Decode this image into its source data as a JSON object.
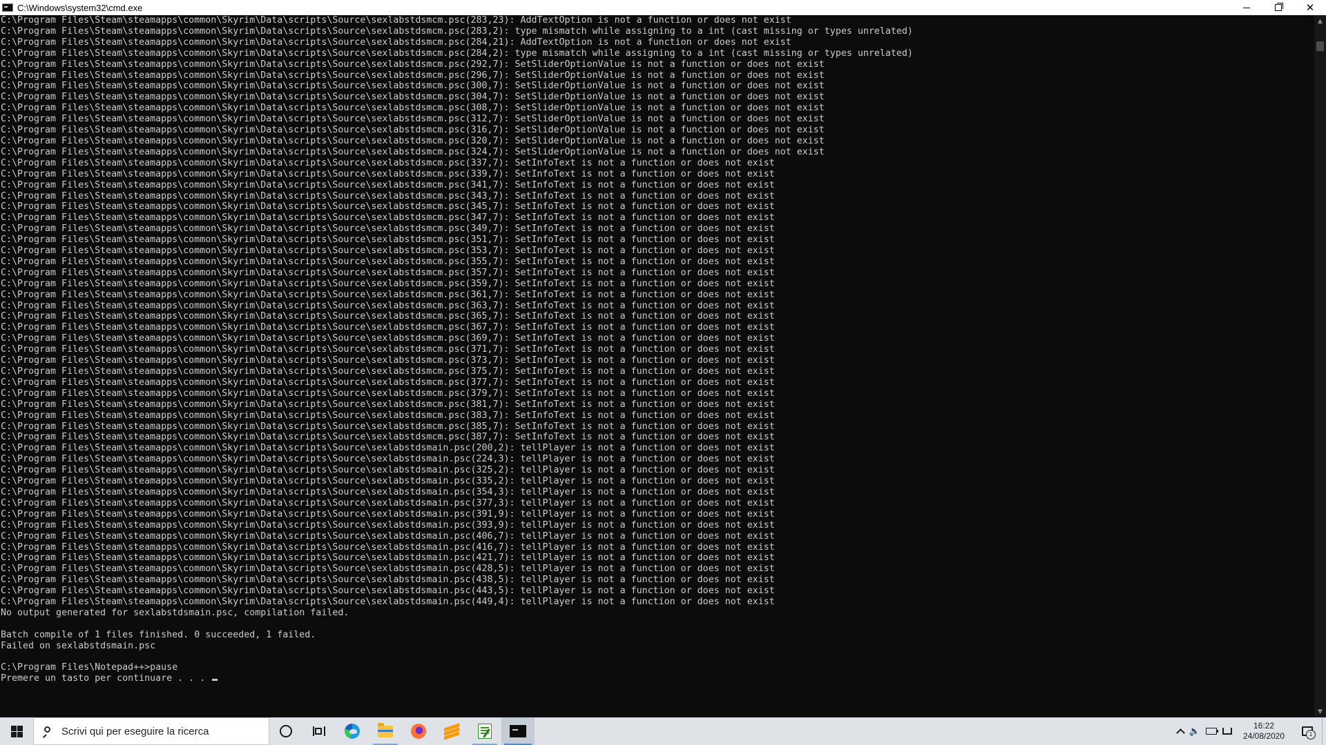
{
  "window": {
    "title": "C:\\Windows\\system32\\cmd.exe",
    "minimize_label": "minimize",
    "maximize_label": "restore",
    "close_label": "close"
  },
  "console": {
    "lines": [
      "C:\\Program Files\\Steam\\steamapps\\common\\Skyrim\\Data\\scripts\\Source\\sexlabstdsmcm.psc(283,23): AddTextOption is not a function or does not exist",
      "C:\\Program Files\\Steam\\steamapps\\common\\Skyrim\\Data\\scripts\\Source\\sexlabstdsmcm.psc(283,2): type mismatch while assigning to a int (cast missing or types unrelated)",
      "C:\\Program Files\\Steam\\steamapps\\common\\Skyrim\\Data\\scripts\\Source\\sexlabstdsmcm.psc(284,21): AddTextOption is not a function or does not exist",
      "C:\\Program Files\\Steam\\steamapps\\common\\Skyrim\\Data\\scripts\\Source\\sexlabstdsmcm.psc(284,2): type mismatch while assigning to a int (cast missing or types unrelated)",
      "C:\\Program Files\\Steam\\steamapps\\common\\Skyrim\\Data\\scripts\\Source\\sexlabstdsmcm.psc(292,7): SetSliderOptionValue is not a function or does not exist",
      "C:\\Program Files\\Steam\\steamapps\\common\\Skyrim\\Data\\scripts\\Source\\sexlabstdsmcm.psc(296,7): SetSliderOptionValue is not a function or does not exist",
      "C:\\Program Files\\Steam\\steamapps\\common\\Skyrim\\Data\\scripts\\Source\\sexlabstdsmcm.psc(300,7): SetSliderOptionValue is not a function or does not exist",
      "C:\\Program Files\\Steam\\steamapps\\common\\Skyrim\\Data\\scripts\\Source\\sexlabstdsmcm.psc(304,7): SetSliderOptionValue is not a function or does not exist",
      "C:\\Program Files\\Steam\\steamapps\\common\\Skyrim\\Data\\scripts\\Source\\sexlabstdsmcm.psc(308,7): SetSliderOptionValue is not a function or does not exist",
      "C:\\Program Files\\Steam\\steamapps\\common\\Skyrim\\Data\\scripts\\Source\\sexlabstdsmcm.psc(312,7): SetSliderOptionValue is not a function or does not exist",
      "C:\\Program Files\\Steam\\steamapps\\common\\Skyrim\\Data\\scripts\\Source\\sexlabstdsmcm.psc(316,7): SetSliderOptionValue is not a function or does not exist",
      "C:\\Program Files\\Steam\\steamapps\\common\\Skyrim\\Data\\scripts\\Source\\sexlabstdsmcm.psc(320,7): SetSliderOptionValue is not a function or does not exist",
      "C:\\Program Files\\Steam\\steamapps\\common\\Skyrim\\Data\\scripts\\Source\\sexlabstdsmcm.psc(324,7): SetSliderOptionValue is not a function or does not exist",
      "C:\\Program Files\\Steam\\steamapps\\common\\Skyrim\\Data\\scripts\\Source\\sexlabstdsmcm.psc(337,7): SetInfoText is not a function or does not exist",
      "C:\\Program Files\\Steam\\steamapps\\common\\Skyrim\\Data\\scripts\\Source\\sexlabstdsmcm.psc(339,7): SetInfoText is not a function or does not exist",
      "C:\\Program Files\\Steam\\steamapps\\common\\Skyrim\\Data\\scripts\\Source\\sexlabstdsmcm.psc(341,7): SetInfoText is not a function or does not exist",
      "C:\\Program Files\\Steam\\steamapps\\common\\Skyrim\\Data\\scripts\\Source\\sexlabstdsmcm.psc(343,7): SetInfoText is not a function or does not exist",
      "C:\\Program Files\\Steam\\steamapps\\common\\Skyrim\\Data\\scripts\\Source\\sexlabstdsmcm.psc(345,7): SetInfoText is not a function or does not exist",
      "C:\\Program Files\\Steam\\steamapps\\common\\Skyrim\\Data\\scripts\\Source\\sexlabstdsmcm.psc(347,7): SetInfoText is not a function or does not exist",
      "C:\\Program Files\\Steam\\steamapps\\common\\Skyrim\\Data\\scripts\\Source\\sexlabstdsmcm.psc(349,7): SetInfoText is not a function or does not exist",
      "C:\\Program Files\\Steam\\steamapps\\common\\Skyrim\\Data\\scripts\\Source\\sexlabstdsmcm.psc(351,7): SetInfoText is not a function or does not exist",
      "C:\\Program Files\\Steam\\steamapps\\common\\Skyrim\\Data\\scripts\\Source\\sexlabstdsmcm.psc(353,7): SetInfoText is not a function or does not exist",
      "C:\\Program Files\\Steam\\steamapps\\common\\Skyrim\\Data\\scripts\\Source\\sexlabstdsmcm.psc(355,7): SetInfoText is not a function or does not exist",
      "C:\\Program Files\\Steam\\steamapps\\common\\Skyrim\\Data\\scripts\\Source\\sexlabstdsmcm.psc(357,7): SetInfoText is not a function or does not exist",
      "C:\\Program Files\\Steam\\steamapps\\common\\Skyrim\\Data\\scripts\\Source\\sexlabstdsmcm.psc(359,7): SetInfoText is not a function or does not exist",
      "C:\\Program Files\\Steam\\steamapps\\common\\Skyrim\\Data\\scripts\\Source\\sexlabstdsmcm.psc(361,7): SetInfoText is not a function or does not exist",
      "C:\\Program Files\\Steam\\steamapps\\common\\Skyrim\\Data\\scripts\\Source\\sexlabstdsmcm.psc(363,7): SetInfoText is not a function or does not exist",
      "C:\\Program Files\\Steam\\steamapps\\common\\Skyrim\\Data\\scripts\\Source\\sexlabstdsmcm.psc(365,7): SetInfoText is not a function or does not exist",
      "C:\\Program Files\\Steam\\steamapps\\common\\Skyrim\\Data\\scripts\\Source\\sexlabstdsmcm.psc(367,7): SetInfoText is not a function or does not exist",
      "C:\\Program Files\\Steam\\steamapps\\common\\Skyrim\\Data\\scripts\\Source\\sexlabstdsmcm.psc(369,7): SetInfoText is not a function or does not exist",
      "C:\\Program Files\\Steam\\steamapps\\common\\Skyrim\\Data\\scripts\\Source\\sexlabstdsmcm.psc(371,7): SetInfoText is not a function or does not exist",
      "C:\\Program Files\\Steam\\steamapps\\common\\Skyrim\\Data\\scripts\\Source\\sexlabstdsmcm.psc(373,7): SetInfoText is not a function or does not exist",
      "C:\\Program Files\\Steam\\steamapps\\common\\Skyrim\\Data\\scripts\\Source\\sexlabstdsmcm.psc(375,7): SetInfoText is not a function or does not exist",
      "C:\\Program Files\\Steam\\steamapps\\common\\Skyrim\\Data\\scripts\\Source\\sexlabstdsmcm.psc(377,7): SetInfoText is not a function or does not exist",
      "C:\\Program Files\\Steam\\steamapps\\common\\Skyrim\\Data\\scripts\\Source\\sexlabstdsmcm.psc(379,7): SetInfoText is not a function or does not exist",
      "C:\\Program Files\\Steam\\steamapps\\common\\Skyrim\\Data\\scripts\\Source\\sexlabstdsmcm.psc(381,7): SetInfoText is not a function or does not exist",
      "C:\\Program Files\\Steam\\steamapps\\common\\Skyrim\\Data\\scripts\\Source\\sexlabstdsmcm.psc(383,7): SetInfoText is not a function or does not exist",
      "C:\\Program Files\\Steam\\steamapps\\common\\Skyrim\\Data\\scripts\\Source\\sexlabstdsmcm.psc(385,7): SetInfoText is not a function or does not exist",
      "C:\\Program Files\\Steam\\steamapps\\common\\Skyrim\\Data\\scripts\\Source\\sexlabstdsmcm.psc(387,7): SetInfoText is not a function or does not exist",
      "C:\\Program Files\\Steam\\steamapps\\common\\Skyrim\\Data\\scripts\\Source\\sexlabstdsmain.psc(200,2): tellPlayer is not a function or does not exist",
      "C:\\Program Files\\Steam\\steamapps\\common\\Skyrim\\Data\\scripts\\Source\\sexlabstdsmain.psc(224,3): tellPlayer is not a function or does not exist",
      "C:\\Program Files\\Steam\\steamapps\\common\\Skyrim\\Data\\scripts\\Source\\sexlabstdsmain.psc(325,2): tellPlayer is not a function or does not exist",
      "C:\\Program Files\\Steam\\steamapps\\common\\Skyrim\\Data\\scripts\\Source\\sexlabstdsmain.psc(335,2): tellPlayer is not a function or does not exist",
      "C:\\Program Files\\Steam\\steamapps\\common\\Skyrim\\Data\\scripts\\Source\\sexlabstdsmain.psc(354,3): tellPlayer is not a function or does not exist",
      "C:\\Program Files\\Steam\\steamapps\\common\\Skyrim\\Data\\scripts\\Source\\sexlabstdsmain.psc(377,3): tellPlayer is not a function or does not exist",
      "C:\\Program Files\\Steam\\steamapps\\common\\Skyrim\\Data\\scripts\\Source\\sexlabstdsmain.psc(391,9): tellPlayer is not a function or does not exist",
      "C:\\Program Files\\Steam\\steamapps\\common\\Skyrim\\Data\\scripts\\Source\\sexlabstdsmain.psc(393,9): tellPlayer is not a function or does not exist",
      "C:\\Program Files\\Steam\\steamapps\\common\\Skyrim\\Data\\scripts\\Source\\sexlabstdsmain.psc(406,7): tellPlayer is not a function or does not exist",
      "C:\\Program Files\\Steam\\steamapps\\common\\Skyrim\\Data\\scripts\\Source\\sexlabstdsmain.psc(416,7): tellPlayer is not a function or does not exist",
      "C:\\Program Files\\Steam\\steamapps\\common\\Skyrim\\Data\\scripts\\Source\\sexlabstdsmain.psc(421,7): tellPlayer is not a function or does not exist",
      "C:\\Program Files\\Steam\\steamapps\\common\\Skyrim\\Data\\scripts\\Source\\sexlabstdsmain.psc(428,5): tellPlayer is not a function or does not exist",
      "C:\\Program Files\\Steam\\steamapps\\common\\Skyrim\\Data\\scripts\\Source\\sexlabstdsmain.psc(438,5): tellPlayer is not a function or does not exist",
      "C:\\Program Files\\Steam\\steamapps\\common\\Skyrim\\Data\\scripts\\Source\\sexlabstdsmain.psc(443,5): tellPlayer is not a function or does not exist",
      "C:\\Program Files\\Steam\\steamapps\\common\\Skyrim\\Data\\scripts\\Source\\sexlabstdsmain.psc(449,4): tellPlayer is not a function or does not exist",
      "No output generated for sexlabstdsmain.psc, compilation failed.",
      "",
      "Batch compile of 1 files finished. 0 succeeded, 1 failed.",
      "Failed on sexlabstdsmain.psc",
      "",
      "C:\\Program Files\\Notepad++>pause",
      "Premere un tasto per continuare . . . "
    ],
    "text_color": "#cccccc",
    "background": "#0c0c0c"
  },
  "taskbar": {
    "search_placeholder": "Scrivi qui per eseguire la ricerca",
    "apps": [
      "cortana",
      "task-view",
      "edge",
      "file-explorer",
      "firefox",
      "sublime-text",
      "notepad-plus-plus",
      "command-prompt"
    ],
    "clock_time": "16:22",
    "clock_date": "24/08/2020",
    "notification_count": "1"
  }
}
